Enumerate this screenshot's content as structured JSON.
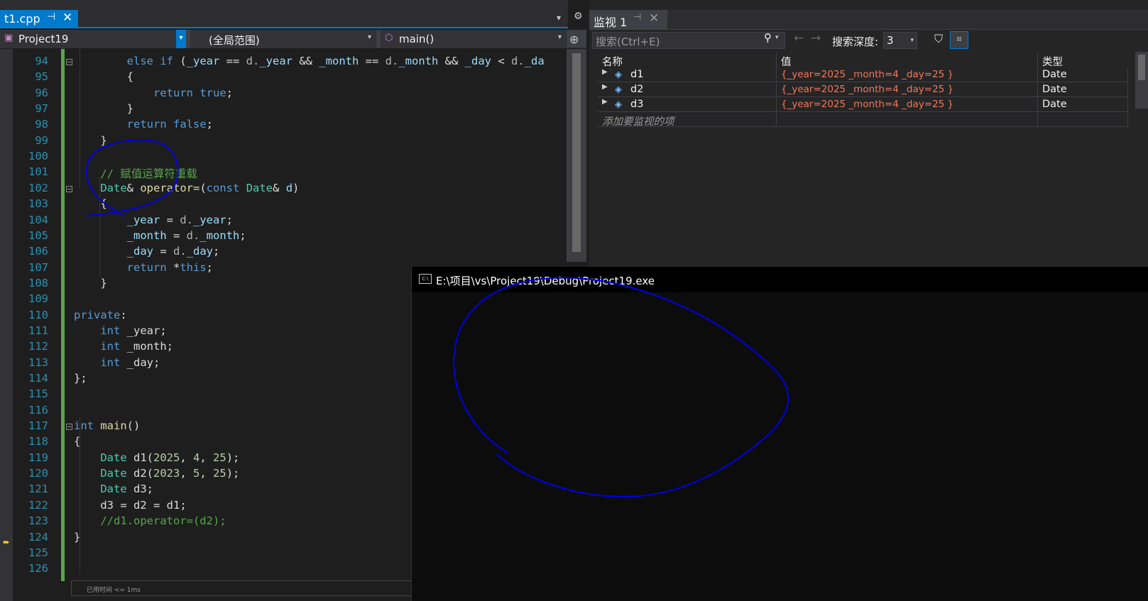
{
  "editor_tab": {
    "file_name": "t1.cpp",
    "pin_glyph": "⊣",
    "close_glyph": "✕",
    "overflow_glyph": "▾",
    "settings_glyph": "⚙"
  },
  "navbar": {
    "project": "Project19",
    "scope": "(全局范围)",
    "function": "main()",
    "project_icon": "project-icon",
    "function_icon": "method-icon"
  },
  "editor": {
    "lines": [
      {
        "num": "94"
      },
      {
        "num": "95"
      },
      {
        "num": "96"
      },
      {
        "num": "97"
      },
      {
        "num": "98"
      },
      {
        "num": "99"
      },
      {
        "num": "100"
      },
      {
        "num": "101"
      },
      {
        "num": "102"
      },
      {
        "num": "103"
      },
      {
        "num": "104"
      },
      {
        "num": "105"
      },
      {
        "num": "106"
      },
      {
        "num": "107"
      },
      {
        "num": "108"
      },
      {
        "num": "109"
      },
      {
        "num": "110"
      },
      {
        "num": "111"
      },
      {
        "num": "112"
      },
      {
        "num": "113"
      },
      {
        "num": "114"
      },
      {
        "num": "115"
      },
      {
        "num": "116"
      },
      {
        "num": "117"
      },
      {
        "num": "118"
      },
      {
        "num": "119"
      },
      {
        "num": "120"
      },
      {
        "num": "121"
      },
      {
        "num": "122"
      },
      {
        "num": "123"
      },
      {
        "num": "124"
      },
      {
        "num": "125"
      },
      {
        "num": "126"
      }
    ],
    "code": {
      "l94": [
        "        ",
        "else if",
        " (",
        "_year",
        " == ",
        "d.",
        "_year",
        " && ",
        "_month",
        " == ",
        "d.",
        "_month",
        " && ",
        "_day",
        " < ",
        "d.",
        "_da"
      ],
      "l95": "        {",
      "l96": [
        "            ",
        "return",
        " ",
        "true",
        ";"
      ],
      "l97": "        }",
      "l98": [
        "        ",
        "return",
        " ",
        "false",
        ";"
      ],
      "l99": "    }",
      "l101": "    // 赋值运算符重载",
      "l102": [
        "    ",
        "Date",
        "& ",
        "operator=",
        "(",
        "const",
        " ",
        "Date",
        "& ",
        "d",
        ")"
      ],
      "l103": "    {",
      "l104": [
        "        ",
        "_year",
        " = ",
        "d.",
        "_year",
        ";"
      ],
      "l105": [
        "        ",
        "_month",
        " = ",
        "d.",
        "_month",
        ";"
      ],
      "l106": [
        "        ",
        "_day",
        " = ",
        "d.",
        "_day",
        ";"
      ],
      "l107": [
        "        ",
        "return",
        " *",
        "this",
        ";"
      ],
      "l108": "    }",
      "l110": [
        "private",
        ":"
      ],
      "l111": [
        "    ",
        "int",
        " _year;"
      ],
      "l112": [
        "    ",
        "int",
        " _month;"
      ],
      "l113": [
        "    ",
        "int",
        " _day;"
      ],
      "l114": "};",
      "l117": [
        "int",
        " ",
        "main",
        "()"
      ],
      "l118": "{",
      "l119": [
        "    ",
        "Date",
        " ",
        "d1",
        "(",
        "2025",
        ", ",
        "4",
        ", ",
        "25",
        ");"
      ],
      "l120": [
        "    ",
        "Date",
        " ",
        "d2",
        "(",
        "2023",
        ", ",
        "5",
        ", ",
        "25",
        ");"
      ],
      "l121": [
        "    ",
        "Date",
        " ",
        "d3",
        ";"
      ],
      "l122": [
        "    ",
        "d3",
        " = ",
        "d2",
        " = ",
        "d1",
        ";"
      ],
      "l123": "    //d1.operator=(d2);",
      "l124": "}"
    },
    "perf_tip": "已用时间 <= 1ms"
  },
  "watch": {
    "tab_label": "监视 1",
    "search_placeholder": "搜索(Ctrl+E)",
    "depth_label": "搜索深度:",
    "depth_value": "3",
    "columns": {
      "name": "名称",
      "value": "值",
      "type": "类型"
    },
    "rows": [
      {
        "name": "d1",
        "value": "{_year=2025 _month=4 _day=25 }",
        "type": "Date"
      },
      {
        "name": "d2",
        "value": "{_year=2025 _month=4 _day=25 }",
        "type": "Date"
      },
      {
        "name": "d3",
        "value": "{_year=2025 _month=4 _day=25 }",
        "type": "Date"
      }
    ],
    "add_watch_placeholder": "添加要监视的项",
    "value_color": "#f0785a"
  },
  "console": {
    "title": "E:\\项目\\vs\\Project19\\Debug\\Project19.exe",
    "icon": "C:\\"
  },
  "colors": {
    "accent": "#007acc",
    "annotation_ink": "#0000e6",
    "keyword": "#569cd6",
    "type": "#4ec9b0",
    "comment": "#57a64a",
    "number": "#b5cea8",
    "line_number": "#2b91af"
  }
}
